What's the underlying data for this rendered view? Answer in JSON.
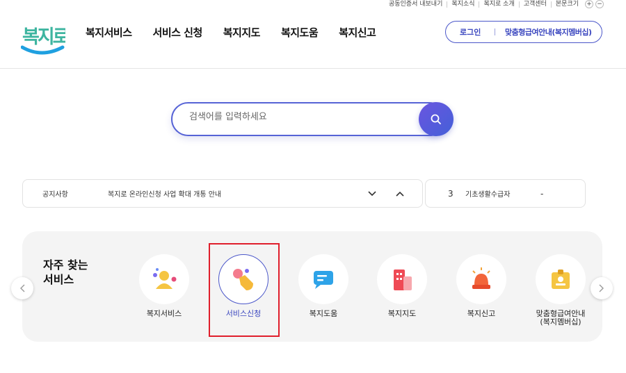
{
  "util_links": [
    "공동인증서 내보내기",
    "복지소식",
    "복지로 소개",
    "고객센터",
    "본문크기"
  ],
  "zoom": {
    "plus": "+",
    "minus": "−"
  },
  "logo": {
    "text": "복지로"
  },
  "gnb": [
    "복지서비스",
    "서비스 신청",
    "복지지도",
    "복지도움",
    "복지신고"
  ],
  "login_pill": {
    "login": "로그인",
    "guide": "맞춤형급여안내(복지멤버십)"
  },
  "search": {
    "placeholder": "검색어를 입력하세요"
  },
  "notice": {
    "label": "공지사항",
    "text": "복지로 온라인신청 사업 확대 개통 안내"
  },
  "status": {
    "number": "3",
    "label": "기초생활수급자",
    "value": "-"
  },
  "freq": {
    "title": "자주 찾는\n서비스",
    "items": [
      {
        "label": "복지서비스",
        "icon": "person-icon"
      },
      {
        "label": "서비스신청",
        "icon": "hand-tap-icon"
      },
      {
        "label": "복지도움",
        "icon": "chat-bubble-icon"
      },
      {
        "label": "복지지도",
        "icon": "building-icon"
      },
      {
        "label": "복지신고",
        "icon": "siren-icon"
      },
      {
        "label": "맞춤형급여안내\n(복지멤버십)",
        "icon": "id-badge-icon"
      }
    ]
  },
  "colors": {
    "accent": "#4a56c9",
    "highlight": "#e01e2b",
    "logo_green": "#3eb5a0",
    "logo_blue": "#1fa0e0"
  }
}
